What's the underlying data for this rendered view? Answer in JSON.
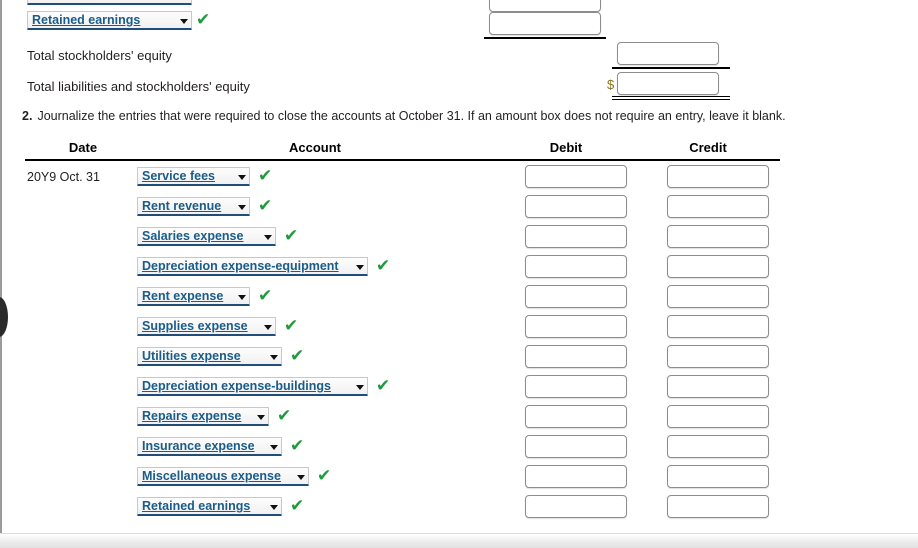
{
  "top_section": {
    "retained_earnings_select": "Retained earnings",
    "total_stockholders_equity_label": "Total stockholders' equity",
    "total_liabilities_equity_label": "Total liabilities and stockholders' equity",
    "currency_symbol": "$",
    "check_mark": "✔",
    "caret": ""
  },
  "instruction": {
    "number": "2.",
    "text": "Journalize the entries that were required to close the accounts at October 31. If an amount box does not require an entry, leave it blank."
  },
  "table": {
    "headers": {
      "date": "Date",
      "account": "Account",
      "debit": "Debit",
      "credit": "Credit"
    },
    "date_value": "20Y9 Oct. 31",
    "rows": [
      {
        "account": "Service fees",
        "debit": "",
        "credit": "",
        "verified": "✔"
      },
      {
        "account": "Rent revenue",
        "debit": "",
        "credit": "",
        "verified": "✔"
      },
      {
        "account": "Salaries expense",
        "debit": "",
        "credit": "",
        "verified": "✔"
      },
      {
        "account": "Depreciation expense-equipment",
        "debit": "",
        "credit": "",
        "verified": "✔"
      },
      {
        "account": "Rent expense",
        "debit": "",
        "credit": "",
        "verified": "✔"
      },
      {
        "account": "Supplies expense",
        "debit": "",
        "credit": "",
        "verified": "✔"
      },
      {
        "account": "Utilities expense",
        "debit": "",
        "credit": "",
        "verified": "✔"
      },
      {
        "account": "Depreciation expense-buildings",
        "debit": "",
        "credit": "",
        "verified": "✔"
      },
      {
        "account": "Repairs expense",
        "debit": "",
        "credit": "",
        "verified": "✔"
      },
      {
        "account": "Insurance expense",
        "debit": "",
        "credit": "",
        "verified": "✔"
      },
      {
        "account": "Miscellaneous expense",
        "debit": "",
        "credit": "",
        "verified": "✔"
      },
      {
        "account": "Retained earnings",
        "debit": "",
        "credit": "",
        "verified": "✔"
      }
    ]
  },
  "colors": {
    "select_text": "#1a5c8a",
    "select_underline": "#1f4e79",
    "check_green": "#1f9a3d",
    "dollar_gold": "#8a7418"
  }
}
